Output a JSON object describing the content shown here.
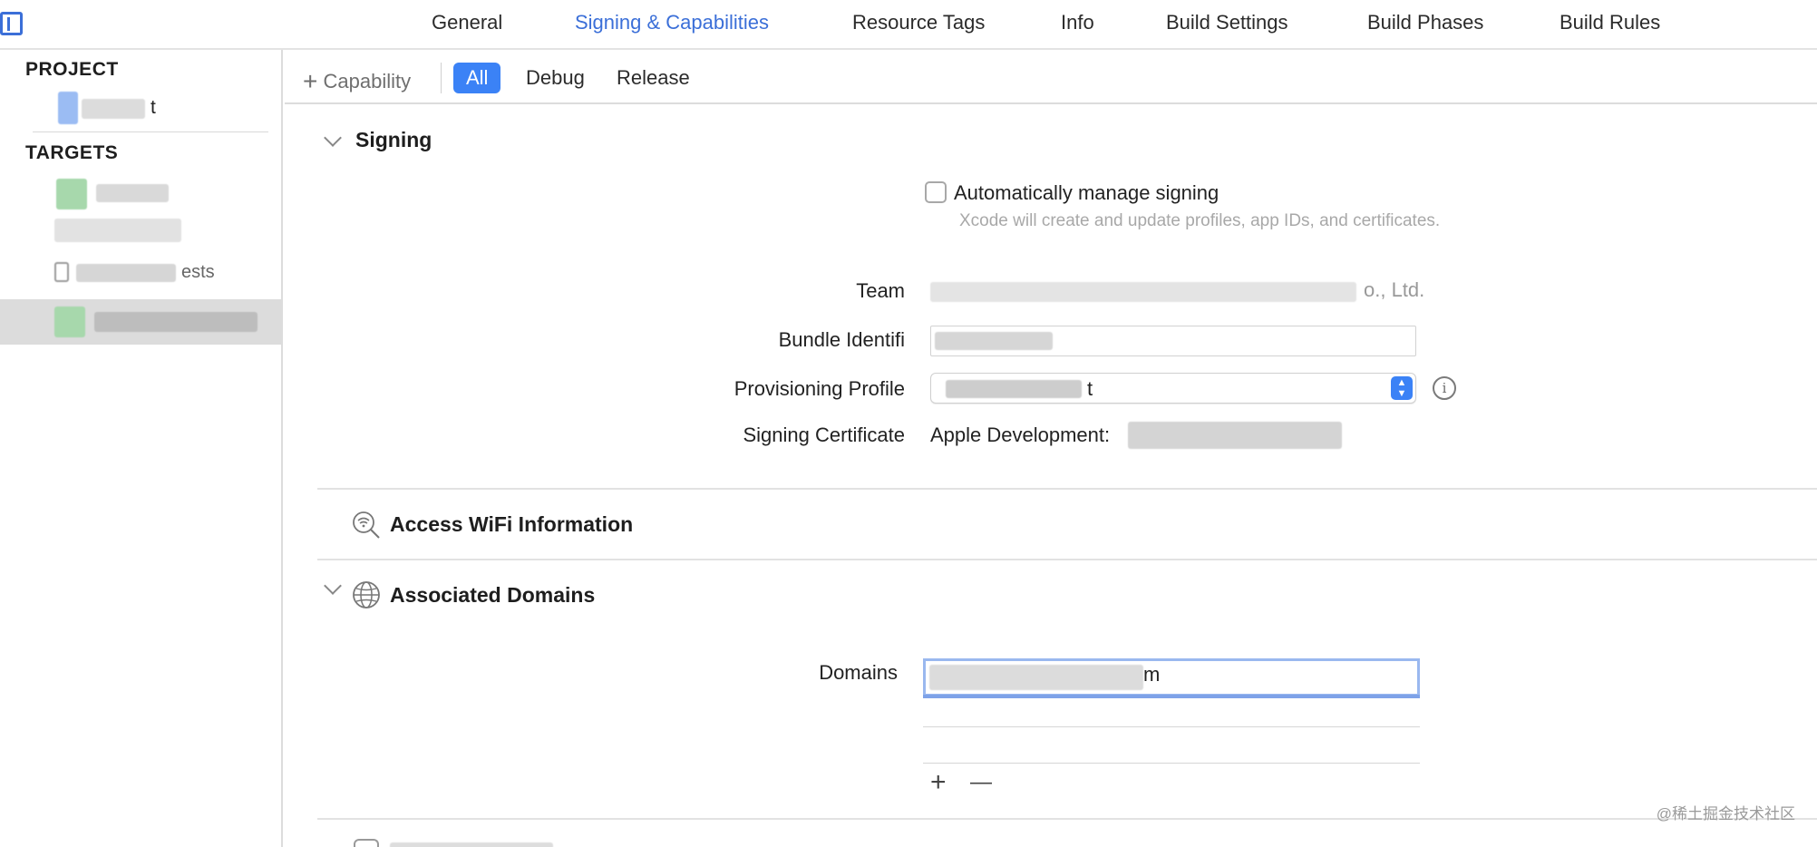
{
  "top_tabs": {
    "items": [
      {
        "label": "General"
      },
      {
        "label": "Signing & Capabilities"
      },
      {
        "label": "Resource Tags"
      },
      {
        "label": "Info"
      },
      {
        "label": "Build Settings"
      },
      {
        "label": "Build Phases"
      },
      {
        "label": "Build Rules"
      }
    ],
    "active": "Signing & Capabilities"
  },
  "sidebar": {
    "project_header": "PROJECT",
    "targets_header": "TARGETS",
    "project_item_fragment": "t",
    "target_item_fragment": "ests"
  },
  "toolbar": {
    "add_capability_label": "Capability",
    "filters": [
      {
        "label": "All"
      },
      {
        "label": "Debug"
      },
      {
        "label": "Release"
      }
    ],
    "active_filter": "All"
  },
  "signing": {
    "title": "Signing",
    "auto_manage_label": "Automatically manage signing",
    "auto_manage_checked": false,
    "help_text": "Xcode will create and update profiles, app IDs, and certificates.",
    "team_label": "Team",
    "team_value_fragment": "o., Ltd.",
    "bundle_label": "Bundle Identifi",
    "profile_label": "Provisioning Profile",
    "profile_value_fragment": "t",
    "certificate_label": "Signing Certificate",
    "certificate_value": "Apple Development:"
  },
  "access_wifi": {
    "title": "Access WiFi Information"
  },
  "associated_domains": {
    "title": "Associated Domains",
    "domains_label": "Domains",
    "domain_value_fragment": "m",
    "add_symbol": "+",
    "remove_symbol": "—"
  },
  "watermark": "@稀土掘金技术社区",
  "colors": {
    "accent": "#3b82f6",
    "tab_active": "#3b6fd8"
  }
}
